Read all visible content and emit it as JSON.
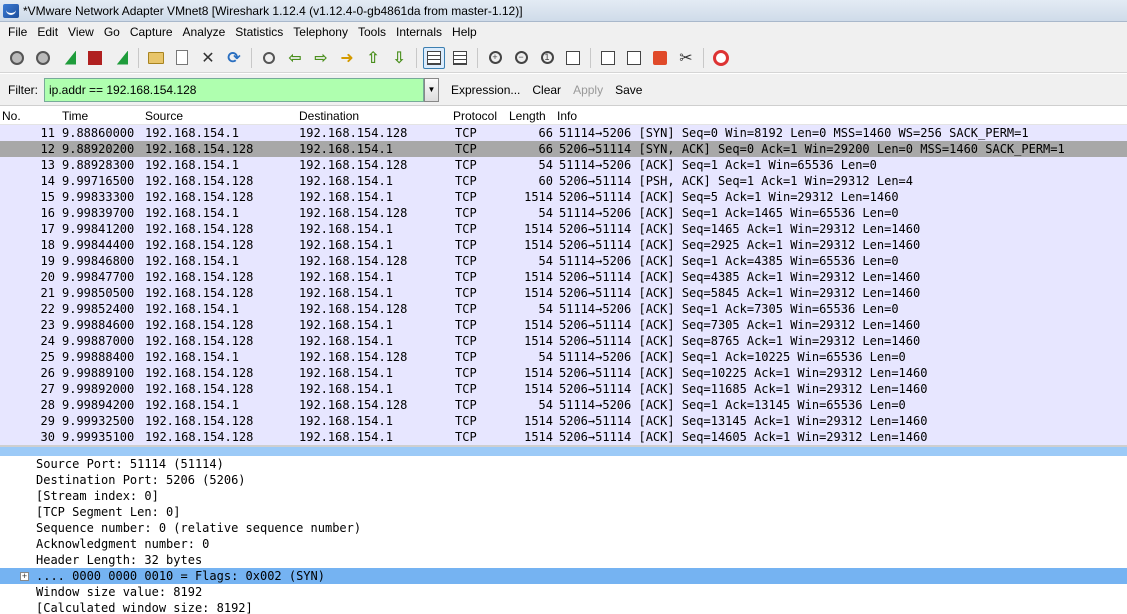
{
  "window": {
    "title": "*VMware Network Adapter VMnet8   [Wireshark 1.12.4  (v1.12.4-0-gb4861da from master-1.12)]"
  },
  "menu": [
    "File",
    "Edit",
    "View",
    "Go",
    "Capture",
    "Analyze",
    "Statistics",
    "Telephony",
    "Tools",
    "Internals",
    "Help"
  ],
  "filter": {
    "label": "Filter:",
    "value": "ip.addr == 192.168.154.128",
    "expression": "Expression...",
    "clear": "Clear",
    "apply": "Apply",
    "save": "Save"
  },
  "packet_list": {
    "columns": [
      "No.",
      "Time",
      "Source",
      "Destination",
      "Protocol",
      "Length",
      "Info"
    ],
    "rows": [
      {
        "no": "11",
        "time": "9.88860000",
        "src": "192.168.154.1",
        "dst": "192.168.154.128",
        "proto": "TCP",
        "len": "66",
        "info": "51114→5206 [SYN] Seq=0 Win=8192 Len=0 MSS=1460 WS=256 SACK_PERM=1"
      },
      {
        "no": "12",
        "time": "9.88920200",
        "src": "192.168.154.128",
        "dst": "192.168.154.1",
        "proto": "TCP",
        "len": "66",
        "info": "5206→51114 [SYN, ACK] Seq=0 Ack=1 Win=29200 Len=0 MSS=1460 SACK_PERM=1"
      },
      {
        "no": "13",
        "time": "9.88928300",
        "src": "192.168.154.1",
        "dst": "192.168.154.128",
        "proto": "TCP",
        "len": "54",
        "info": "51114→5206 [ACK] Seq=1 Ack=1 Win=65536 Len=0"
      },
      {
        "no": "14",
        "time": "9.99716500",
        "src": "192.168.154.128",
        "dst": "192.168.154.1",
        "proto": "TCP",
        "len": "60",
        "info": "5206→51114 [PSH, ACK] Seq=1 Ack=1 Win=29312 Len=4"
      },
      {
        "no": "15",
        "time": "9.99833300",
        "src": "192.168.154.128",
        "dst": "192.168.154.1",
        "proto": "TCP",
        "len": "1514",
        "info": "5206→51114 [ACK] Seq=5 Ack=1 Win=29312 Len=1460"
      },
      {
        "no": "16",
        "time": "9.99839700",
        "src": "192.168.154.1",
        "dst": "192.168.154.128",
        "proto": "TCP",
        "len": "54",
        "info": "51114→5206 [ACK] Seq=1 Ack=1465 Win=65536 Len=0"
      },
      {
        "no": "17",
        "time": "9.99841200",
        "src": "192.168.154.128",
        "dst": "192.168.154.1",
        "proto": "TCP",
        "len": "1514",
        "info": "5206→51114 [ACK] Seq=1465 Ack=1 Win=29312 Len=1460"
      },
      {
        "no": "18",
        "time": "9.99844400",
        "src": "192.168.154.128",
        "dst": "192.168.154.1",
        "proto": "TCP",
        "len": "1514",
        "info": "5206→51114 [ACK] Seq=2925 Ack=1 Win=29312 Len=1460"
      },
      {
        "no": "19",
        "time": "9.99846800",
        "src": "192.168.154.1",
        "dst": "192.168.154.128",
        "proto": "TCP",
        "len": "54",
        "info": "51114→5206 [ACK] Seq=1 Ack=4385 Win=65536 Len=0"
      },
      {
        "no": "20",
        "time": "9.99847700",
        "src": "192.168.154.128",
        "dst": "192.168.154.1",
        "proto": "TCP",
        "len": "1514",
        "info": "5206→51114 [ACK] Seq=4385 Ack=1 Win=29312 Len=1460"
      },
      {
        "no": "21",
        "time": "9.99850500",
        "src": "192.168.154.128",
        "dst": "192.168.154.1",
        "proto": "TCP",
        "len": "1514",
        "info": "5206→51114 [ACK] Seq=5845 Ack=1 Win=29312 Len=1460"
      },
      {
        "no": "22",
        "time": "9.99852400",
        "src": "192.168.154.1",
        "dst": "192.168.154.128",
        "proto": "TCP",
        "len": "54",
        "info": "51114→5206 [ACK] Seq=1 Ack=7305 Win=65536 Len=0"
      },
      {
        "no": "23",
        "time": "9.99884600",
        "src": "192.168.154.128",
        "dst": "192.168.154.1",
        "proto": "TCP",
        "len": "1514",
        "info": "5206→51114 [ACK] Seq=7305 Ack=1 Win=29312 Len=1460"
      },
      {
        "no": "24",
        "time": "9.99887000",
        "src": "192.168.154.128",
        "dst": "192.168.154.1",
        "proto": "TCP",
        "len": "1514",
        "info": "5206→51114 [ACK] Seq=8765 Ack=1 Win=29312 Len=1460"
      },
      {
        "no": "25",
        "time": "9.99888400",
        "src": "192.168.154.1",
        "dst": "192.168.154.128",
        "proto": "TCP",
        "len": "54",
        "info": "51114→5206 [ACK] Seq=1 Ack=10225 Win=65536 Len=0"
      },
      {
        "no": "26",
        "time": "9.99889100",
        "src": "192.168.154.128",
        "dst": "192.168.154.1",
        "proto": "TCP",
        "len": "1514",
        "info": "5206→51114 [ACK] Seq=10225 Ack=1 Win=29312 Len=1460"
      },
      {
        "no": "27",
        "time": "9.99892000",
        "src": "192.168.154.128",
        "dst": "192.168.154.1",
        "proto": "TCP",
        "len": "1514",
        "info": "5206→51114 [ACK] Seq=11685 Ack=1 Win=29312 Len=1460"
      },
      {
        "no": "28",
        "time": "9.99894200",
        "src": "192.168.154.1",
        "dst": "192.168.154.128",
        "proto": "TCP",
        "len": "54",
        "info": "51114→5206 [ACK] Seq=1 Ack=13145 Win=65536 Len=0"
      },
      {
        "no": "29",
        "time": "9.99932500",
        "src": "192.168.154.128",
        "dst": "192.168.154.1",
        "proto": "TCP",
        "len": "1514",
        "info": "5206→51114 [ACK] Seq=13145 Ack=1 Win=29312 Len=1460"
      },
      {
        "no": "30",
        "time": "9.99935100",
        "src": "192.168.154.128",
        "dst": "192.168.154.1",
        "proto": "TCP",
        "len": "1514",
        "info": "5206→51114 [ACK] Seq=14605 Ack=1 Win=29312 Len=1460"
      }
    ],
    "selected_row": "12"
  },
  "detail": {
    "lines": [
      "Source Port: 51114 (51114)",
      "Destination Port: 5206 (5206)",
      "[Stream index: 0]",
      "[TCP Segment Len: 0]",
      "Sequence number: 0    (relative sequence number)",
      "Acknowledgment number: 0",
      "Header Length: 32 bytes",
      ".... 0000 0000 0010 = Flags: 0x002 (SYN)",
      "Window size value: 8192",
      "[Calculated window size: 8192]"
    ],
    "expand_symbol": "+"
  }
}
